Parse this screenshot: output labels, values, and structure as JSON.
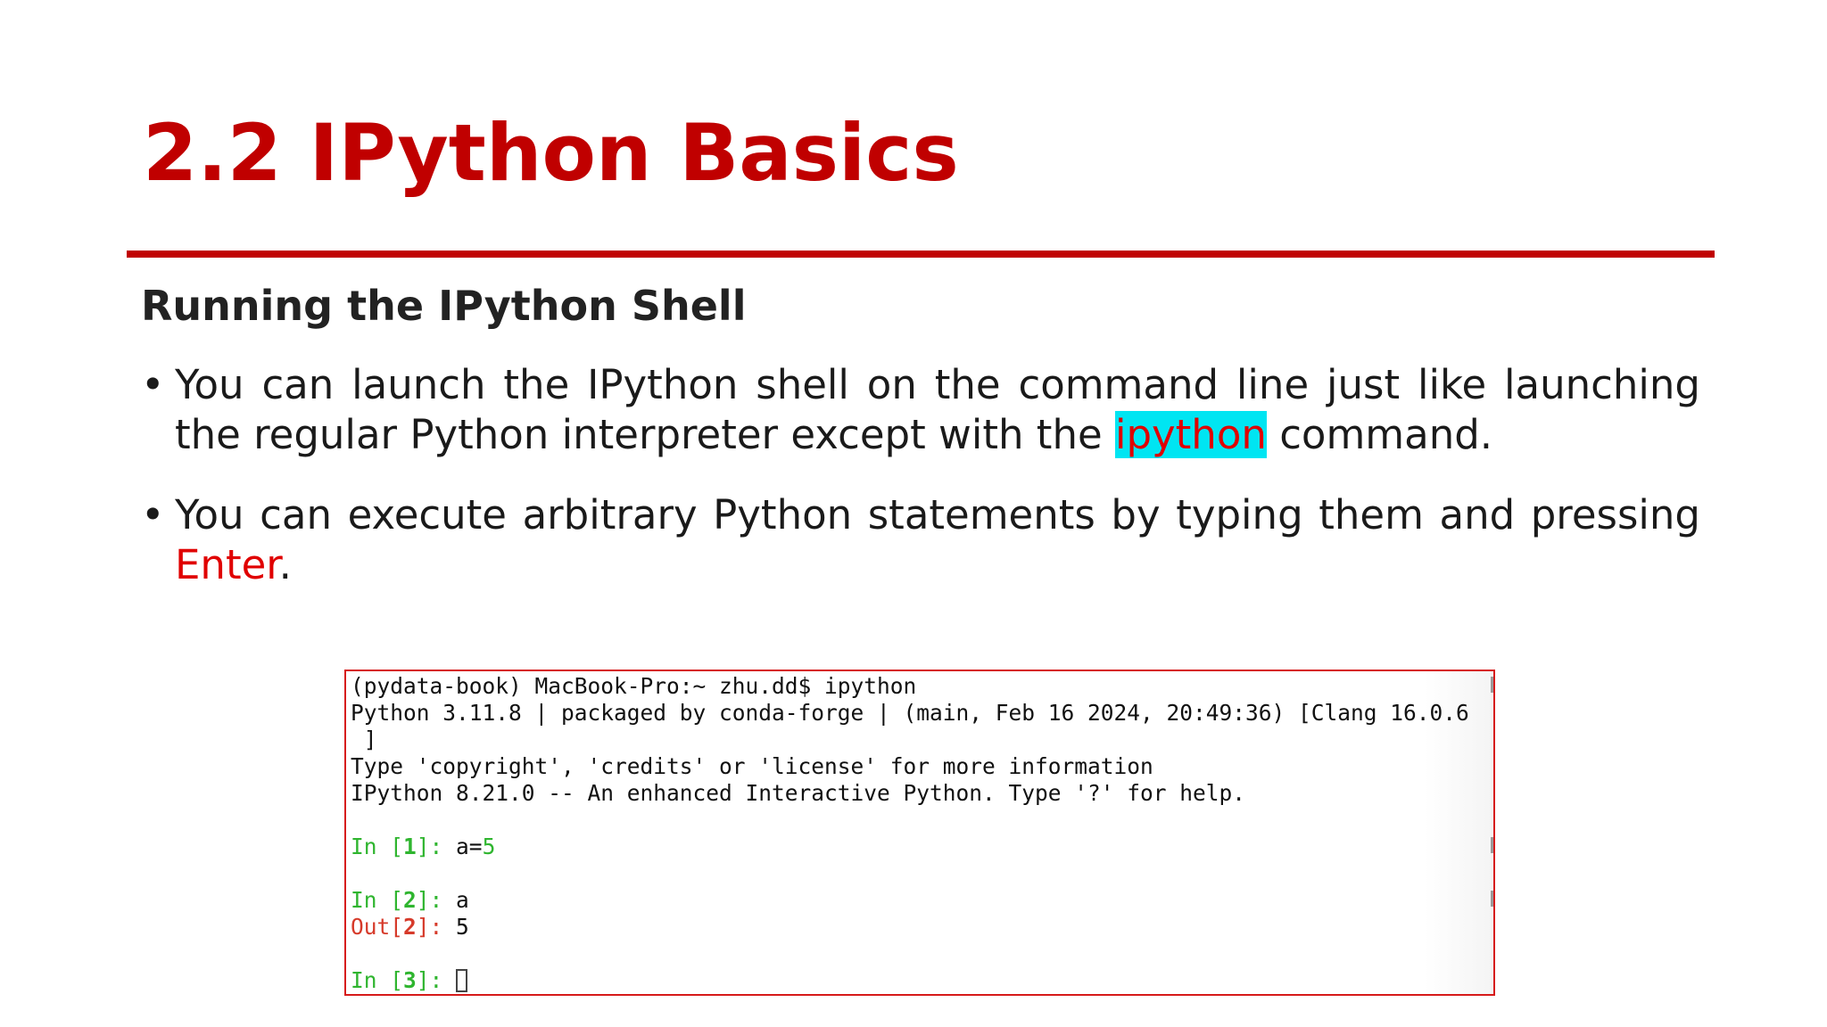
{
  "slide": {
    "title": "2.2 IPython Basics",
    "subtitle": "Running the IPython Shell",
    "bullet_symbol": "•",
    "bullets": [
      {
        "before": "You can launch the IPython shell on the command line just like launching the regular Python interpreter except with the ",
        "highlight": "ipython",
        "after": " command."
      },
      {
        "before": "You can execute arbitrary Python statements by typing them and pressing ",
        "highlight": "Enter",
        "after": "."
      }
    ],
    "colors": {
      "title": "#c00000",
      "rule": "#c00000",
      "highlight_text": "#e00000",
      "highlight_background": "#00e5f2",
      "terminal_border": "#d61a1a",
      "prompt_in": "#2fb52f",
      "prompt_out": "#d63a2a"
    }
  },
  "terminal": {
    "lines": {
      "command": "(pydata-book) MacBook-Pro:~ zhu.dd$ ipython",
      "version": "Python 3.11.8 | packaged by conda-forge | (main, Feb 16 2024, 20:49:36) [Clang 16.0.6",
      "version_cont": " ]",
      "info": "Type 'copyright', 'credits' or 'license' for more information",
      "banner": "IPython 8.21.0 -- An enhanced Interactive Python. Type '?' for help."
    },
    "in1": {
      "prompt_open": "In [",
      "number": "1",
      "prompt_close": "]: ",
      "code_name": "a=",
      "code_value": "5"
    },
    "in2": {
      "prompt_open": "In [",
      "number": "2",
      "prompt_close": "]: ",
      "code": "a"
    },
    "out2": {
      "prompt_open": "Out[",
      "number": "2",
      "prompt_close": "]: ",
      "value": "5"
    },
    "in3": {
      "prompt_open": "In [",
      "number": "3",
      "prompt_close": "]: "
    }
  }
}
